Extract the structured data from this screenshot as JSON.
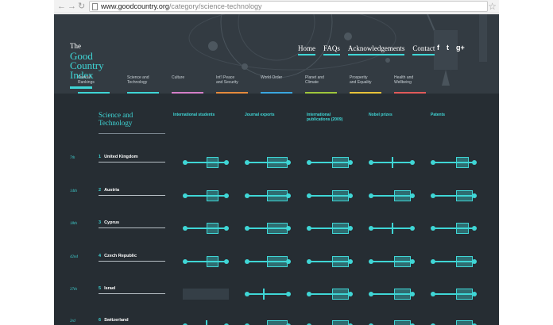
{
  "browser": {
    "back_icon": "back-arrow-icon",
    "forward_icon": "forward-arrow-icon",
    "reload_icon": "reload-icon",
    "url_host": "www.goodcountry.org",
    "url_path": "/category/science-technology",
    "bookmark_icon": "star-icon"
  },
  "site": {
    "logo": {
      "the": "The",
      "line1": "Good",
      "line2": "Country",
      "line3": "Index"
    },
    "nav": [
      "Home",
      "FAQs",
      "Acknowledgements",
      "Contact"
    ],
    "social": {
      "facebook": "f",
      "twitter": "t",
      "google": "g+"
    },
    "categories": [
      {
        "line1": "Overall",
        "line2": "Rankings",
        "color": "#3fd6d6"
      },
      {
        "line1": "Science and",
        "line2": "Technology",
        "color": "#3fd6d6"
      },
      {
        "line1": "Culture",
        "line2": "",
        "color": "#d47fc8"
      },
      {
        "line1": "Int'l Peace",
        "line2": "and Security",
        "color": "#e58a3c"
      },
      {
        "line1": "World Order",
        "line2": "",
        "color": "#3aa6e0"
      },
      {
        "line1": "Planet and",
        "line2": "Climate",
        "color": "#9ec63c"
      },
      {
        "line1": "Prosperity",
        "line2": "and Equality",
        "color": "#e8c33a"
      },
      {
        "line1": "Health and",
        "line2": "Wellbeing",
        "color": "#e05a5a"
      }
    ]
  },
  "table": {
    "title_line1": "Science and",
    "title_line2": "Technology",
    "columns": [
      {
        "line1": "International students",
        "line2": ""
      },
      {
        "line1": "Journal exports",
        "line2": ""
      },
      {
        "line1": "International",
        "line2": "publications (2009)"
      },
      {
        "line1": "Nobel prizes",
        "line2": ""
      },
      {
        "line1": "Patents",
        "line2": ""
      }
    ],
    "rows": [
      {
        "rank": "7th",
        "num": "1",
        "country": "United Kingdom",
        "sliders": [
          {
            "box": [
              0.52,
              0.78
            ],
            "line": null,
            "empty": false
          },
          {
            "box": [
              0.48,
              0.92
            ],
            "line": null,
            "empty": false
          },
          {
            "box": [
              0.55,
              0.92
            ],
            "line": null,
            "empty": false
          },
          {
            "box": null,
            "line": 0.5,
            "empty": false
          },
          {
            "box": [
              0.55,
              0.82
            ],
            "line": null,
            "empty": false
          }
        ]
      },
      {
        "rank": "14th",
        "num": "2",
        "country": "Austria",
        "sliders": [
          {
            "box": [
              0.52,
              0.78
            ],
            "line": null,
            "empty": false
          },
          {
            "box": [
              0.48,
              0.92
            ],
            "line": null,
            "empty": false
          },
          {
            "box": [
              0.55,
              0.92
            ],
            "line": null,
            "empty": false
          },
          {
            "box": [
              0.55,
              0.92
            ],
            "line": null,
            "empty": false
          },
          {
            "box": [
              0.55,
              0.92
            ],
            "line": null,
            "empty": false
          }
        ]
      },
      {
        "rank": "18th",
        "num": "3",
        "country": "Cyprus",
        "sliders": [
          {
            "box": [
              0.52,
              0.78
            ],
            "line": null,
            "empty": false
          },
          {
            "box": [
              0.48,
              0.92
            ],
            "line": null,
            "empty": false
          },
          {
            "box": [
              0.55,
              0.92
            ],
            "line": null,
            "empty": false
          },
          {
            "box": null,
            "line": 0.5,
            "empty": false
          },
          {
            "box": [
              0.55,
              0.82
            ],
            "line": null,
            "empty": false
          }
        ]
      },
      {
        "rank": "42nd",
        "num": "4",
        "country": "Czech Republic",
        "sliders": [
          {
            "box": [
              0.52,
              0.78
            ],
            "line": null,
            "empty": false
          },
          {
            "box": [
              0.48,
              0.92
            ],
            "line": null,
            "empty": false
          },
          {
            "box": [
              0.55,
              0.92
            ],
            "line": null,
            "empty": false
          },
          {
            "box": [
              0.55,
              0.92
            ],
            "line": null,
            "empty": false
          },
          {
            "box": [
              0.55,
              0.92
            ],
            "line": null,
            "empty": false
          }
        ]
      },
      {
        "rank": "37th",
        "num": "5",
        "country": "Israel",
        "sliders": [
          {
            "box": null,
            "line": null,
            "empty": true
          },
          {
            "box": null,
            "line": 0.4,
            "empty": false
          },
          {
            "box": [
              0.55,
              0.92
            ],
            "line": null,
            "empty": false
          },
          {
            "box": [
              0.55,
              0.92
            ],
            "line": null,
            "empty": false
          },
          {
            "box": [
              0.55,
              0.92
            ],
            "line": null,
            "empty": false
          }
        ]
      },
      {
        "rank": "3rd",
        "num": "6",
        "country": "Switzerland",
        "sliders": [
          {
            "box": null,
            "line": 0.5,
            "empty": false
          },
          {
            "box": [
              0.48,
              0.92
            ],
            "line": null,
            "empty": false
          },
          {
            "box": [
              0.55,
              0.92
            ],
            "line": null,
            "empty": false
          },
          {
            "box": [
              0.55,
              0.92
            ],
            "line": null,
            "empty": false
          },
          {
            "box": [
              0.55,
              0.92
            ],
            "line": null,
            "empty": false
          }
        ]
      }
    ]
  },
  "colors": {
    "accent": "#3fd6d6",
    "background": "#262d33",
    "hero": "#333b42"
  }
}
